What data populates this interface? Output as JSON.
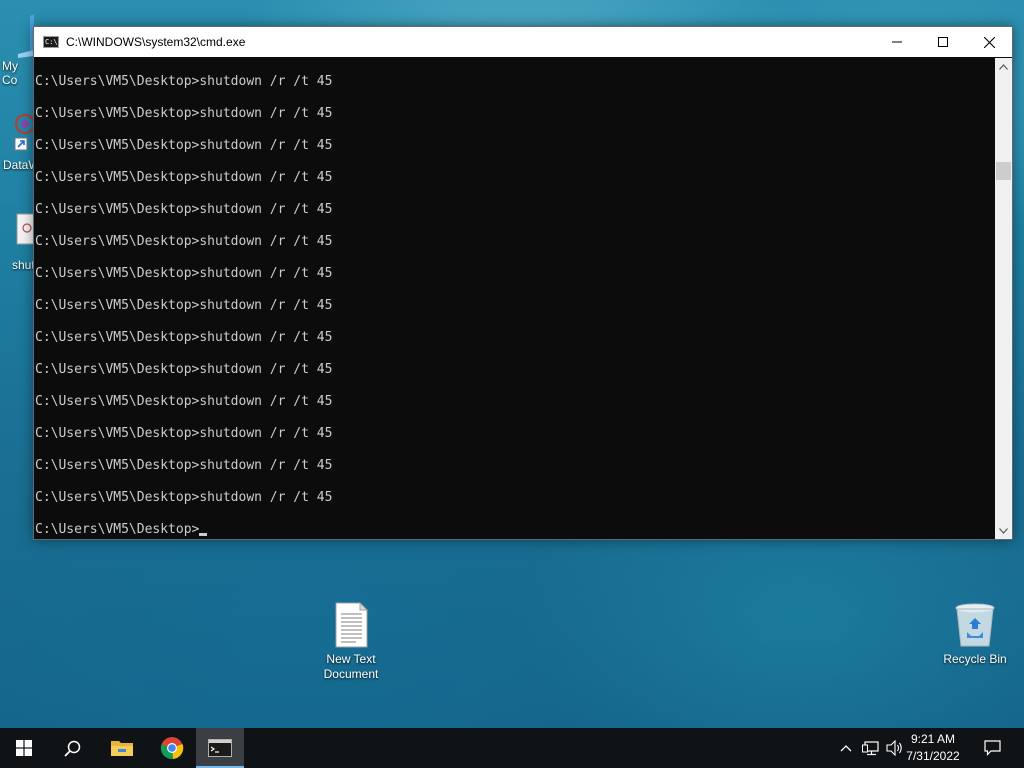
{
  "desktop": {
    "partial_icons": [
      {
        "label": "My Co",
        "name": "my-computer"
      },
      {
        "label": "DataW",
        "name": "dataw-shortcut"
      },
      {
        "label": "shut",
        "name": "shutdown-file"
      }
    ],
    "icons": [
      {
        "label": "New Text Document",
        "icon": "text-document-icon"
      },
      {
        "label": "Recycle Bin",
        "icon": "recycle-bin-icon"
      }
    ]
  },
  "window": {
    "title": "C:\\WINDOWS\\system32\\cmd.exe",
    "icon_text": "C:\\_",
    "controls": {
      "minimize": "minimize-icon",
      "maximize": "maximize-icon",
      "close": "close-icon"
    }
  },
  "console": {
    "lines": [
      "C:\\Users\\VM5\\Desktop>shutdown /r /t 45",
      "C:\\Users\\VM5\\Desktop>shutdown /r /t 45",
      "C:\\Users\\VM5\\Desktop>shutdown /r /t 45",
      "C:\\Users\\VM5\\Desktop>shutdown /r /t 45",
      "C:\\Users\\VM5\\Desktop>shutdown /r /t 45",
      "C:\\Users\\VM5\\Desktop>shutdown /r /t 45",
      "C:\\Users\\VM5\\Desktop>shutdown /r /t 45",
      "C:\\Users\\VM5\\Desktop>shutdown /r /t 45",
      "C:\\Users\\VM5\\Desktop>shutdown /r /t 45",
      "C:\\Users\\VM5\\Desktop>shutdown /r /t 45",
      "C:\\Users\\VM5\\Desktop>shutdown /r /t 45",
      "C:\\Users\\VM5\\Desktop>shutdown /r /t 45",
      "C:\\Users\\VM5\\Desktop>shutdown /r /t 45",
      "C:\\Users\\VM5\\Desktop>shutdown /r /t 45"
    ],
    "prompt": "C:\\Users\\VM5\\Desktop>"
  },
  "taskbar": {
    "buttons": [
      "start-icon",
      "search-icon",
      "file-explorer-icon",
      "chrome-icon",
      "cmd-icon"
    ],
    "tray": [
      "chevron-up-icon",
      "network-icon",
      "volume-icon"
    ],
    "time": "9:21 AM",
    "date": "7/31/2022",
    "notification": "notification-icon"
  },
  "colors": {
    "console_bg": "#0c0c0c",
    "console_fg": "#cccccc",
    "taskbar_bg": "#101316",
    "accent": "#76b9ed"
  }
}
